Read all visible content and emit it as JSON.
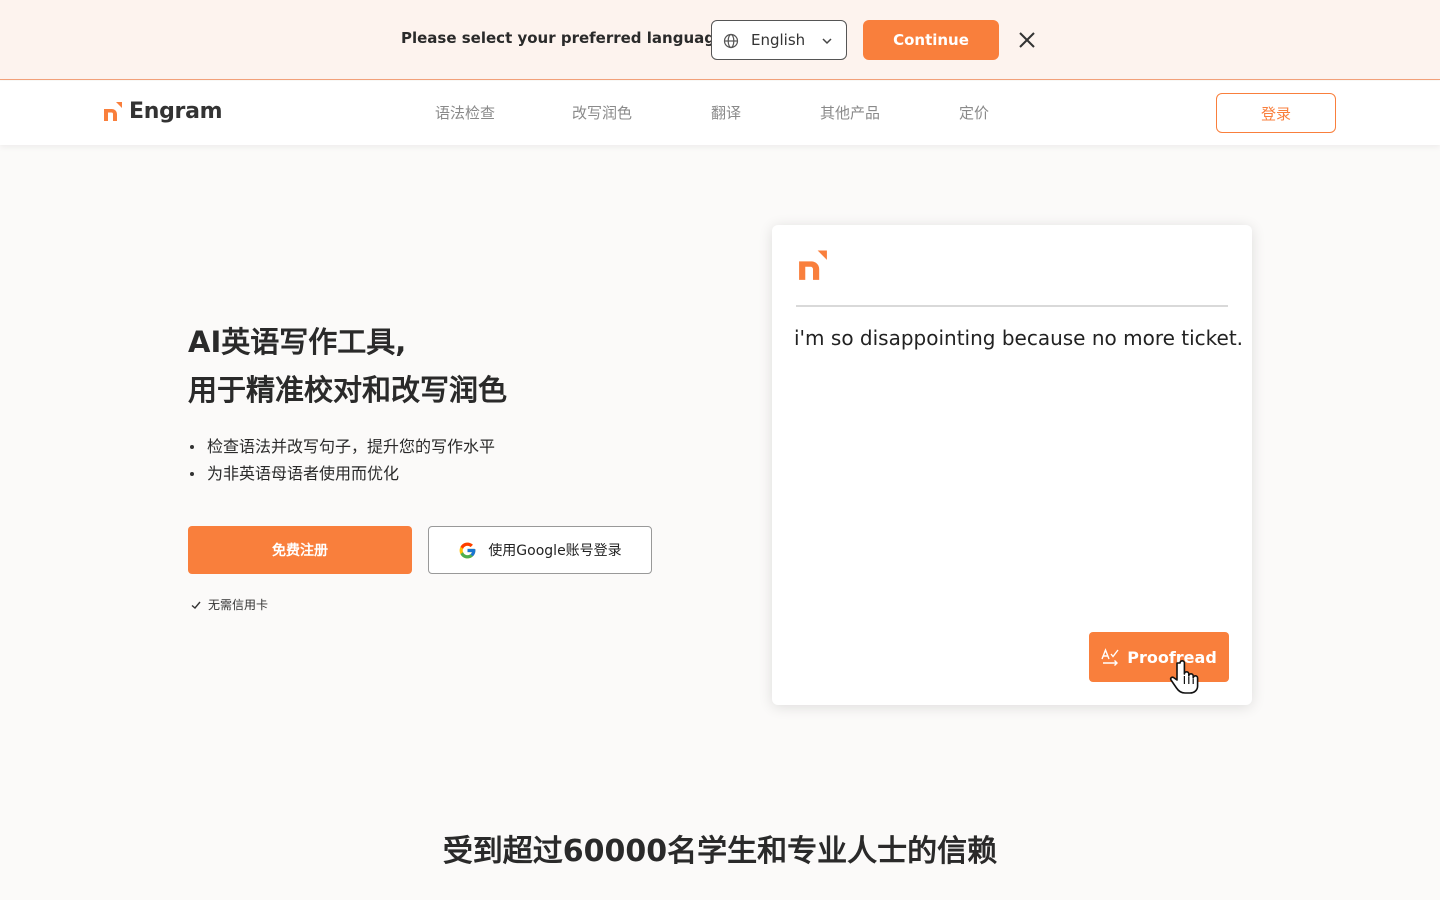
{
  "banner": {
    "prompt": "Please select your preferred language.",
    "language": "English",
    "continue_label": "Continue"
  },
  "nav": {
    "brand": "Engram",
    "items": [
      "语法检查",
      "改写润色",
      "翻译",
      "其他产品",
      "定价"
    ],
    "login_label": "登录"
  },
  "hero": {
    "title_line1": "AI英语写作工具,",
    "title_line2": "用于精准校对和改写润色",
    "bullets": [
      "检查语法并改写句子，提升您的写作水平",
      "为非英语母语者使用而优化"
    ],
    "signup_label": "免费注册",
    "google_label": "使用Google账号登录",
    "no_card": "无需信用卡"
  },
  "demo": {
    "text": "i'm so disappointing because no more ticket.",
    "proofread_label": "Proofread"
  },
  "trust": {
    "title": "受到超过60000名学生和专业人士的信赖"
  },
  "colors": {
    "accent": "#f97f3c",
    "banner_bg": "#fdf3ee",
    "page_bg": "#fbfaf9"
  }
}
